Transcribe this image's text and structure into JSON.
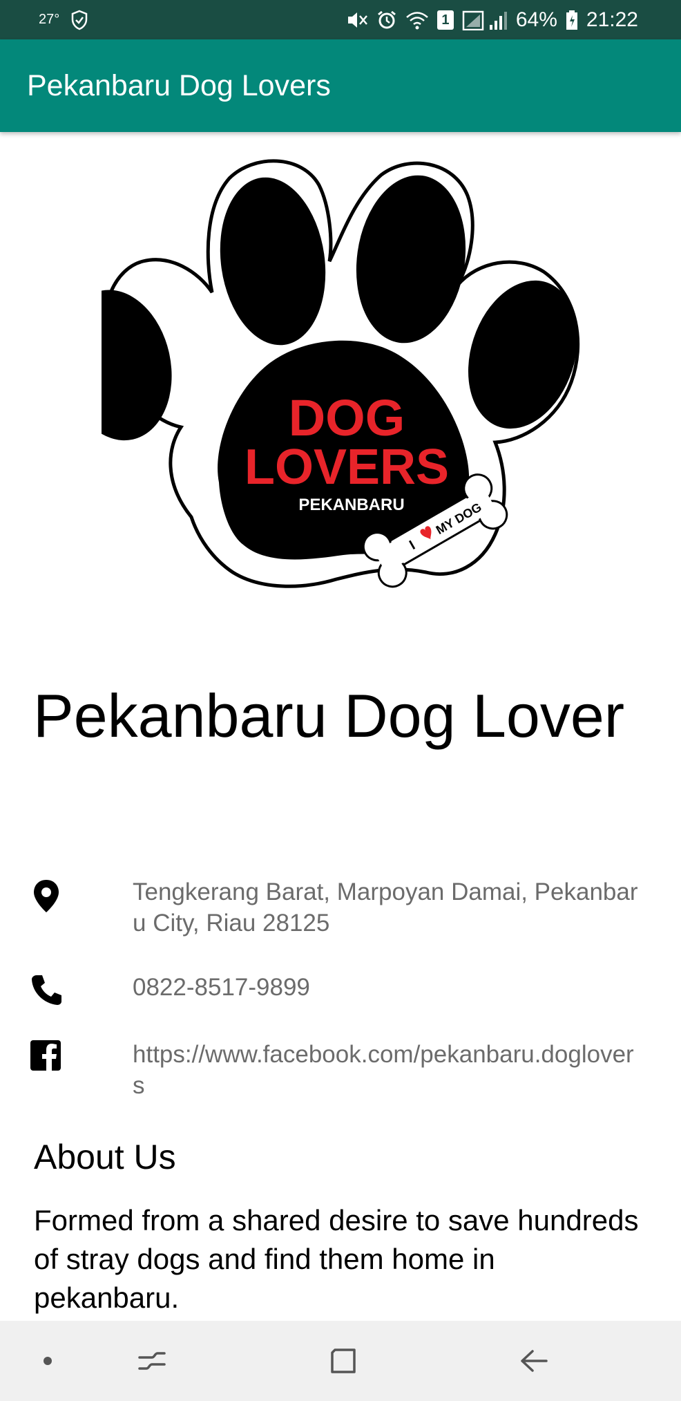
{
  "status_bar": {
    "temperature": "27°",
    "battery": "64%",
    "time": "21:22",
    "sim_indicator": "1",
    "icons": [
      "shield-check-icon",
      "mute-icon",
      "alarm-icon",
      "wifi-icon",
      "signal-icon",
      "battery-icon"
    ]
  },
  "app_bar": {
    "title": "Pekanbaru Dog Lovers",
    "background_color": "#03887a"
  },
  "logo": {
    "line1": "DOG",
    "line2": "LOVERS",
    "line3": "PEKANBARU",
    "bone_left": "I",
    "bone_right": "MY DOG"
  },
  "place": {
    "name": "Pekanbaru Dog Lover"
  },
  "info": {
    "address": {
      "icon": "location-pin-icon",
      "text": "Tengkerang Barat, Marpoyan Damai, Pekanbaru City, Riau 28125"
    },
    "phone": {
      "icon": "phone-icon",
      "text": "0822-8517-9899"
    },
    "facebook": {
      "icon": "facebook-icon",
      "text": "https://www.facebook.com/pekanbaru.doglovers"
    }
  },
  "about": {
    "heading": "About Us",
    "text": "Formed from a shared desire to save hundreds of stray dogs and find them home in pekanbaru."
  },
  "nav_bar": {
    "icons": [
      "dot-icon",
      "recent-apps-icon",
      "home-icon",
      "back-icon"
    ]
  }
}
